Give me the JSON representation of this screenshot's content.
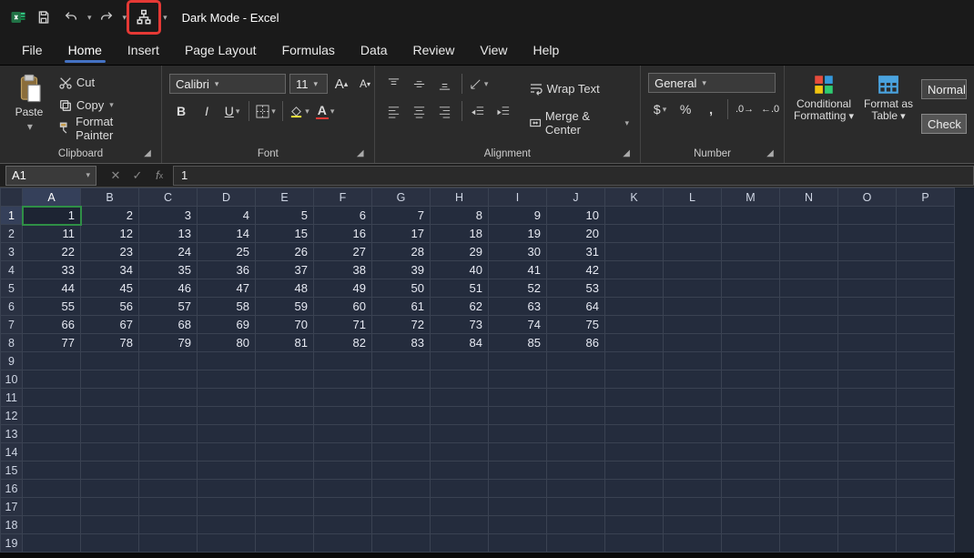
{
  "titlebar": {
    "title": "Dark Mode  -  Excel"
  },
  "menu": [
    "File",
    "Home",
    "Insert",
    "Page Layout",
    "Formulas",
    "Data",
    "Review",
    "View",
    "Help"
  ],
  "menu_active_index": 1,
  "ribbon": {
    "clipboard": {
      "paste": "Paste",
      "cut": "Cut",
      "copy": "Copy",
      "format_painter": "Format Painter",
      "label": "Clipboard"
    },
    "font": {
      "name": "Calibri",
      "size": "11",
      "label": "Font"
    },
    "alignment": {
      "wrap": "Wrap Text",
      "merge": "Merge & Center",
      "label": "Alignment"
    },
    "number": {
      "format": "General",
      "label": "Number"
    },
    "styles": {
      "conditional": "Conditional Formatting",
      "format_table": "Format as Table",
      "normal": "Normal",
      "check": "Check"
    }
  },
  "namebox": "A1",
  "formula": "1",
  "columns": [
    "A",
    "B",
    "C",
    "D",
    "E",
    "F",
    "G",
    "H",
    "I",
    "J",
    "K",
    "L",
    "M",
    "N",
    "O",
    "P"
  ],
  "row_count": 19,
  "selected": {
    "row": 1,
    "col": 0
  },
  "cells": [
    [
      1,
      2,
      3,
      4,
      5,
      6,
      7,
      8,
      9,
      10
    ],
    [
      11,
      12,
      13,
      14,
      15,
      16,
      17,
      18,
      19,
      20
    ],
    [
      22,
      23,
      24,
      25,
      26,
      27,
      28,
      29,
      30,
      31
    ],
    [
      33,
      34,
      35,
      36,
      37,
      38,
      39,
      40,
      41,
      42
    ],
    [
      44,
      45,
      46,
      47,
      48,
      49,
      50,
      51,
      52,
      53
    ],
    [
      55,
      56,
      57,
      58,
      59,
      60,
      61,
      62,
      63,
      64
    ],
    [
      66,
      67,
      68,
      69,
      70,
      71,
      72,
      73,
      74,
      75
    ],
    [
      77,
      78,
      79,
      80,
      81,
      82,
      83,
      84,
      85,
      86
    ]
  ]
}
